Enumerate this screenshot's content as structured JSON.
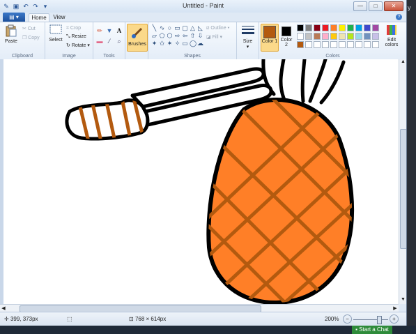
{
  "window": {
    "title": "Untitled - Paint",
    "controls": {
      "minimize": "—",
      "maximize": "□",
      "close": "✕"
    }
  },
  "tabs": {
    "file": "▤ ▾",
    "items": [
      {
        "label": "Home"
      },
      {
        "label": "View"
      }
    ],
    "help": "?"
  },
  "ribbon": {
    "clipboard": {
      "label": "Clipboard",
      "paste": "Paste",
      "cut": "Cut",
      "copy": "Copy"
    },
    "image": {
      "label": "Image",
      "select": "Select",
      "crop": "Crop",
      "resize": "Resize",
      "rotate": "Rotate ▾"
    },
    "tools": {
      "label": "Tools",
      "text": "A"
    },
    "brushes": {
      "label": "Brushes"
    },
    "shapes": {
      "label": "Shapes",
      "outline": "Outline ▾",
      "fill": "Fill ▾"
    },
    "size": {
      "label": "Size"
    },
    "colors": {
      "label": "Colors",
      "color1": "Color 1",
      "color2": "Color 2",
      "edit": "Edit colors",
      "color1_value": "#b35a0f",
      "color2_value": "#000000",
      "palette": [
        "#000000",
        "#7f7f7f",
        "#880015",
        "#ed1c24",
        "#ff7f27",
        "#fff200",
        "#22b14c",
        "#00a2e8",
        "#3f48cc",
        "#a349a4",
        "#ffffff",
        "#c3c3c3",
        "#b97a57",
        "#ffaec9",
        "#ffc90e",
        "#efe4b0",
        "#b5e61d",
        "#99d9ea",
        "#7092be",
        "#c8bfe7",
        "#b35a0f",
        "#ffffff",
        "#ffffff",
        "#ffffff",
        "#ffffff",
        "#ffffff",
        "#ffffff",
        "#ffffff",
        "#ffffff",
        "#ffffff"
      ]
    }
  },
  "drawing": {
    "fill": "#ff7f27",
    "stripe": "#b35a0f",
    "outline": "#000000"
  },
  "status": {
    "cursor": "399, 373px",
    "size": "768 × 614px",
    "zoom": "200%",
    "zoom_level": 0.75
  },
  "taskbar": {
    "chat": "Start a Chat"
  }
}
